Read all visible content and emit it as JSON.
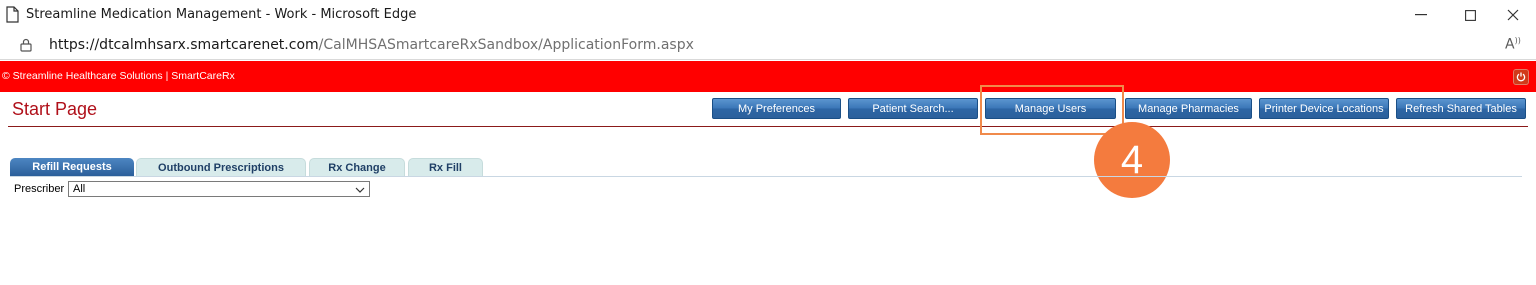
{
  "window": {
    "title": "Streamline Medication Management - Work - Microsoft Edge"
  },
  "address": {
    "host": "https://dtcalmhsarx.smartcarenet.com",
    "path": "/CalMHSASmartcareRxSandbox/ApplicationForm.aspx"
  },
  "app_header": {
    "copyright": "© Streamline Healthcare Solutions | SmartCareRx",
    "brand_color": "#ff0000"
  },
  "page": {
    "title": "Start Page"
  },
  "toolbar": {
    "my_preferences": "My Preferences",
    "patient_search": "Patient Search...",
    "manage_users": "Manage Users",
    "manage_pharmacies": "Manage Pharmacies",
    "printer_device_locations": "Printer Device Locations",
    "refresh_shared_tables": "Refresh Shared Tables"
  },
  "annotation": {
    "step_number": "4",
    "color": "#f47b3e"
  },
  "tabs": [
    {
      "label": "Refill Requests",
      "active": true
    },
    {
      "label": "Outbound Prescriptions",
      "active": false
    },
    {
      "label": "Rx Change",
      "active": false
    },
    {
      "label": "Rx Fill",
      "active": false
    }
  ],
  "filters": {
    "prescriber_label": "Prescriber",
    "prescriber_value": "All"
  }
}
